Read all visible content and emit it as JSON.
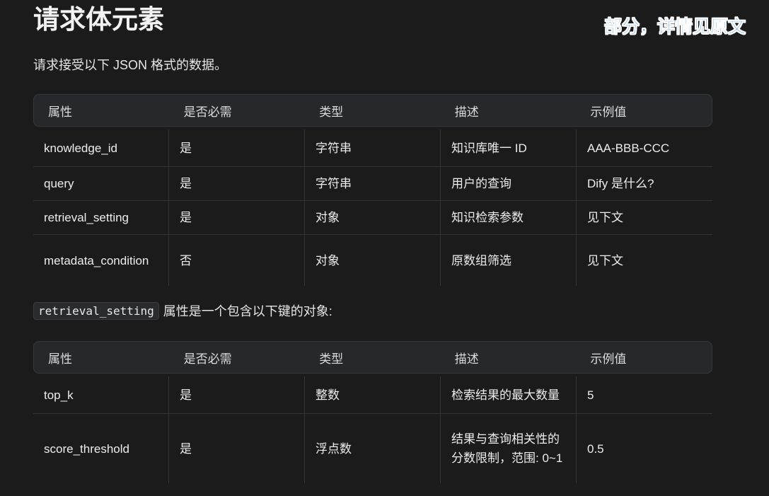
{
  "heading": "请求体元素",
  "note": "部分，详情见原文",
  "intro": "请求接受以下 JSON 格式的数据。",
  "table1": {
    "headers": [
      "属性",
      "是否必需",
      "类型",
      "描述",
      "示例值"
    ],
    "rows": [
      [
        "knowledge_id",
        "是",
        "字符串",
        "知识库唯一 ID",
        "AAA-BBB-CCC"
      ],
      [
        "query",
        "是",
        "字符串",
        "用户的查询",
        "Dify 是什么?"
      ],
      [
        "retrieval_setting",
        "是",
        "对象",
        "知识检索参数",
        "见下文"
      ],
      [
        "metadata_condition",
        "否",
        "对象",
        "原数组筛选",
        "见下文"
      ]
    ]
  },
  "mid": {
    "code": "retrieval_setting",
    "text": "属性是一个包含以下键的对象:"
  },
  "table2": {
    "headers": [
      "属性",
      "是否必需",
      "类型",
      "描述",
      "示例值"
    ],
    "rows": [
      [
        "top_k",
        "是",
        "整数",
        "检索结果的最大数量",
        "5"
      ],
      [
        "score_threshold",
        "是",
        "浮点数",
        "结果与查询相关性的分数限制，范围: 0~1",
        "0.5"
      ]
    ]
  }
}
